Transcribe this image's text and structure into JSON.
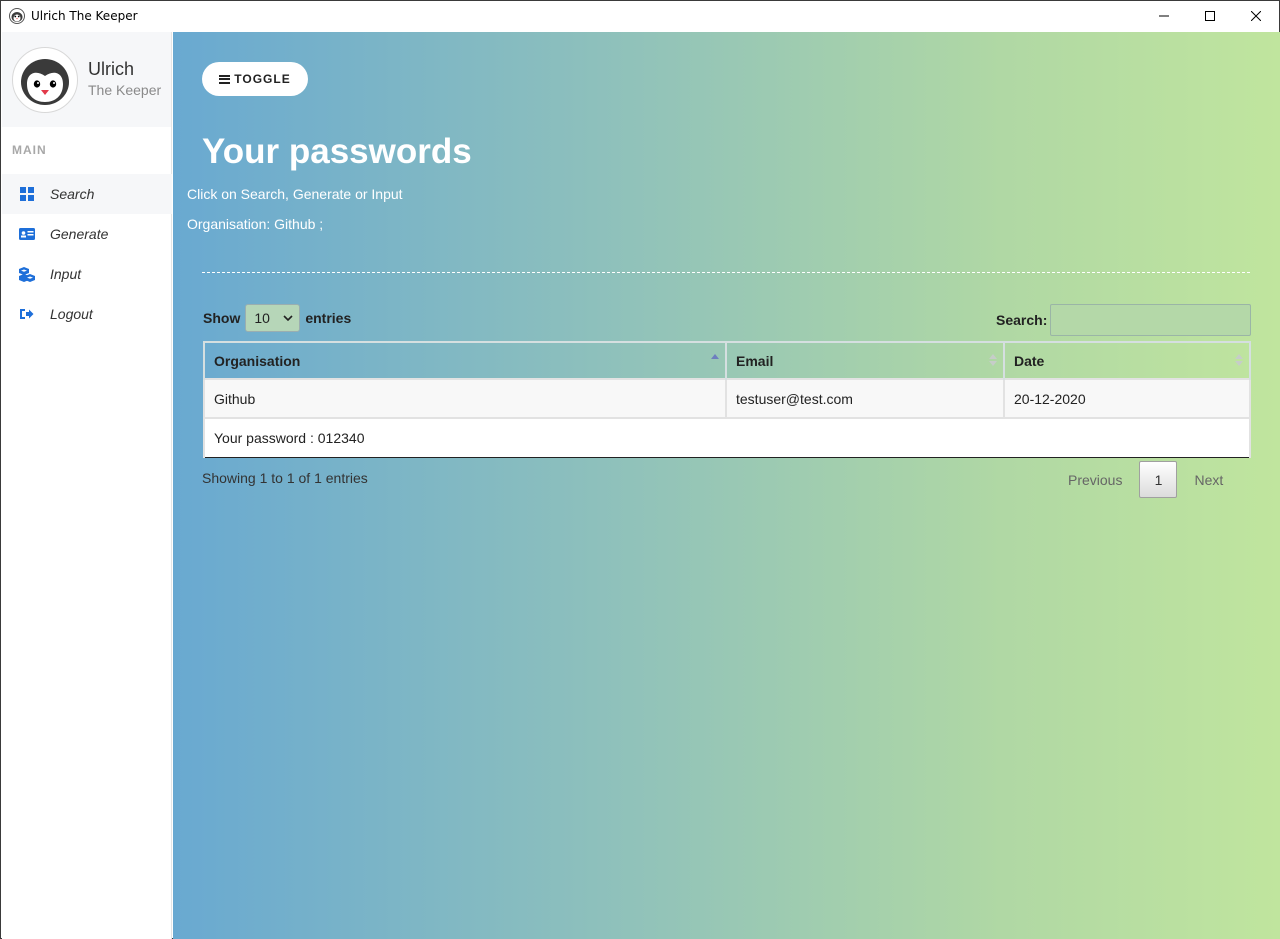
{
  "window": {
    "title": "Ulrich The Keeper",
    "controls": [
      "minimize-icon",
      "maximize-icon",
      "close-icon"
    ]
  },
  "sidebar": {
    "profile": {
      "name": "Ulrich",
      "subtitle": "The Keeper"
    },
    "section_label": "MAIN",
    "items": [
      {
        "label": "Search",
        "icon": "grid-icon",
        "active": true
      },
      {
        "label": "Generate",
        "icon": "id-card-icon",
        "active": false
      },
      {
        "label": "Input",
        "icon": "cubes-icon",
        "active": false
      },
      {
        "label": "Logout",
        "icon": "sign-out-icon",
        "active": false
      }
    ]
  },
  "main": {
    "toggle_label": "TOGGLE",
    "title": "Your passwords",
    "hint": "Click on Search, Generate or Input",
    "org_line": "Organisation: Github ;",
    "table_controls": {
      "show_label": "Show",
      "entries_label": "entries",
      "page_size": "10",
      "search_label": "Search:",
      "search_value": ""
    },
    "table": {
      "columns": [
        "Organisation",
        "Email",
        "Date"
      ],
      "rows": [
        {
          "organisation": "Github",
          "email": "testuser@test.com",
          "date": "20-12-2020",
          "detail": "Your password : 012340"
        }
      ]
    },
    "footer": {
      "info": "Showing 1 to 1 of 1 entries",
      "previous": "Previous",
      "current_page": "1",
      "next": "Next"
    }
  },
  "colors": {
    "gradient_start": "#69a9d1",
    "gradient_end": "#c0e59e",
    "nav_icon": "#1e6fd9"
  }
}
